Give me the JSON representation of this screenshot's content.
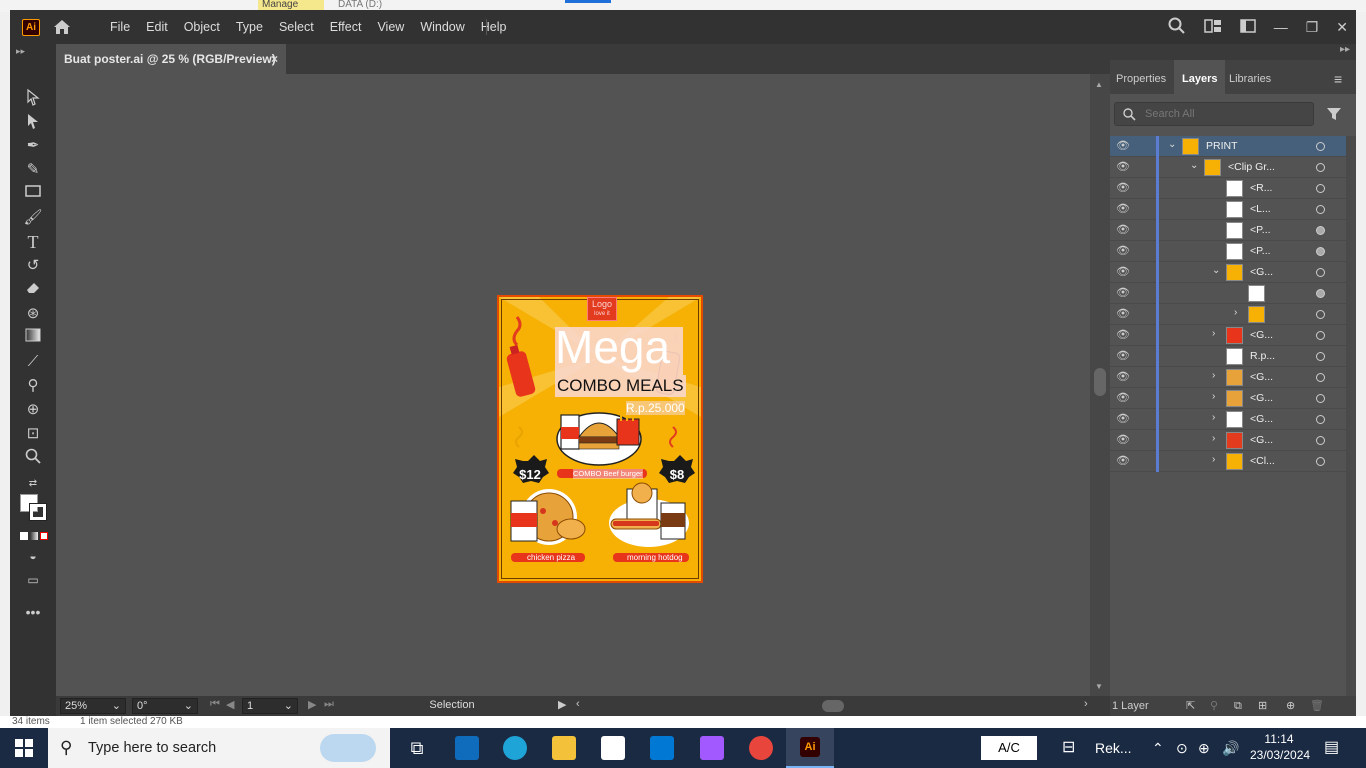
{
  "window": {
    "app_logo": "Ai",
    "menu": [
      "File",
      "Edit",
      "Object",
      "Type",
      "Select",
      "Effect",
      "View",
      "Window",
      "Help"
    ]
  },
  "background": {
    "top_tab_label": "Manage",
    "top_tab_label2": "DATA (D:)",
    "bottom_left_1": "34 items",
    "bottom_left_2": "1 item selected  270 KB"
  },
  "document": {
    "tab_title": "Buat poster.ai @ 25 % (RGB/Preview)",
    "close": "×"
  },
  "status": {
    "zoom": "25%",
    "rotation": "0°",
    "artboard": "1",
    "tool": "Selection"
  },
  "panel": {
    "tabs": [
      "Properties",
      "Layers",
      "Libraries"
    ],
    "search_placeholder": "Search All",
    "layer_count": "1 Layer",
    "layers": [
      {
        "name": "PRINT",
        "indent": 0,
        "chevron": "down",
        "selected": true,
        "filled": false
      },
      {
        "name": "<Clip Gr...",
        "indent": 1,
        "chevron": "down",
        "selected": false,
        "filled": false
      },
      {
        "name": "<R...",
        "indent": 2,
        "chevron": "",
        "selected": false,
        "filled": false
      },
      {
        "name": "<L...",
        "indent": 2,
        "chevron": "",
        "selected": false,
        "filled": false
      },
      {
        "name": "<P...",
        "indent": 2,
        "chevron": "",
        "selected": false,
        "filled": true
      },
      {
        "name": "<P...",
        "indent": 2,
        "chevron": "",
        "selected": false,
        "filled": true
      },
      {
        "name": "<G...",
        "indent": 2,
        "chevron": "down",
        "selected": false,
        "filled": false
      },
      {
        "name": "",
        "indent": 3,
        "chevron": "",
        "selected": false,
        "filled": true
      },
      {
        "name": "",
        "indent": 3,
        "chevron": "right",
        "selected": false,
        "filled": false
      },
      {
        "name": "<G...",
        "indent": 2,
        "chevron": "right",
        "selected": false,
        "filled": false
      },
      {
        "name": "R.p...",
        "indent": 2,
        "chevron": "",
        "selected": false,
        "filled": false
      },
      {
        "name": "<G...",
        "indent": 2,
        "chevron": "right",
        "selected": false,
        "filled": false
      },
      {
        "name": "<G...",
        "indent": 2,
        "chevron": "right",
        "selected": false,
        "filled": false
      },
      {
        "name": "<G...",
        "indent": 2,
        "chevron": "right",
        "selected": false,
        "filled": false
      },
      {
        "name": "<G...",
        "indent": 2,
        "chevron": "right",
        "selected": false,
        "filled": false
      },
      {
        "name": "<Cl...",
        "indent": 2,
        "chevron": "right",
        "selected": false,
        "filled": false
      }
    ]
  },
  "poster": {
    "logo": "Logo",
    "logo_sub": "love it",
    "headline": "Mega",
    "subhead": "COMBO MEALS",
    "price": "R.p.25.000",
    "badge_left": "$12",
    "badge_right": "$8",
    "combo_label": "COMBO Beef burger",
    "label_left": "chicken pizza",
    "label_right": "morning hotdog"
  },
  "taskbar": {
    "search_placeholder": "Type here to search",
    "keyboard": "A/C",
    "rec_label": "Rek...",
    "time": "11:14",
    "date": "23/03/2024"
  },
  "colors": {
    "accent": "#ff9a00",
    "poster_bg": "#f6b104",
    "poster_border": "#e44b00",
    "selection": "#46607b"
  }
}
